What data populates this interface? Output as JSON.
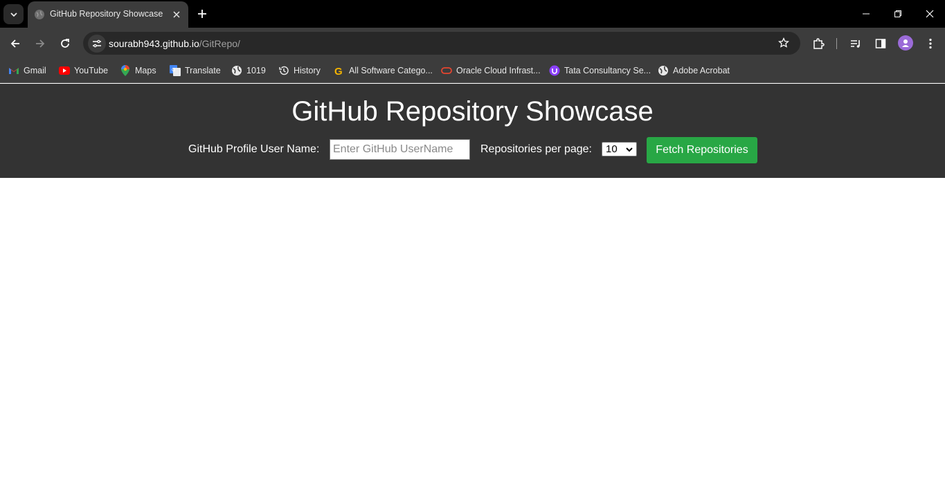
{
  "browser": {
    "tab": {
      "title": "GitHub Repository Showcase"
    },
    "url": {
      "host": "sourabh943.github.io",
      "path": "/GitRepo/"
    },
    "bookmarks": [
      {
        "label": "Gmail",
        "icon": "gmail-icon"
      },
      {
        "label": "YouTube",
        "icon": "youtube-icon"
      },
      {
        "label": "Maps",
        "icon": "maps-icon"
      },
      {
        "label": "Translate",
        "icon": "translate-icon"
      },
      {
        "label": "1019",
        "icon": "globe-icon"
      },
      {
        "label": "History",
        "icon": "history-icon"
      },
      {
        "label": "All Software Catego...",
        "icon": "g-logo-icon"
      },
      {
        "label": "Oracle Cloud Infrast...",
        "icon": "oracle-icon"
      },
      {
        "label": "Tata Consultancy Se...",
        "icon": "tcs-icon"
      },
      {
        "label": "Adobe Acrobat",
        "icon": "globe-icon"
      }
    ]
  },
  "page": {
    "title": "GitHub Repository Showcase",
    "username_label": "GitHub Profile User Name:",
    "username_placeholder": "Enter GitHub UserName",
    "per_page_label": "Repositories per page:",
    "per_page_value": "10",
    "fetch_button": "Fetch Repositories"
  },
  "colors": {
    "header_bg": "#333333",
    "fetch_button_bg": "#28a745",
    "browser_chrome": "#3c3c3c"
  }
}
